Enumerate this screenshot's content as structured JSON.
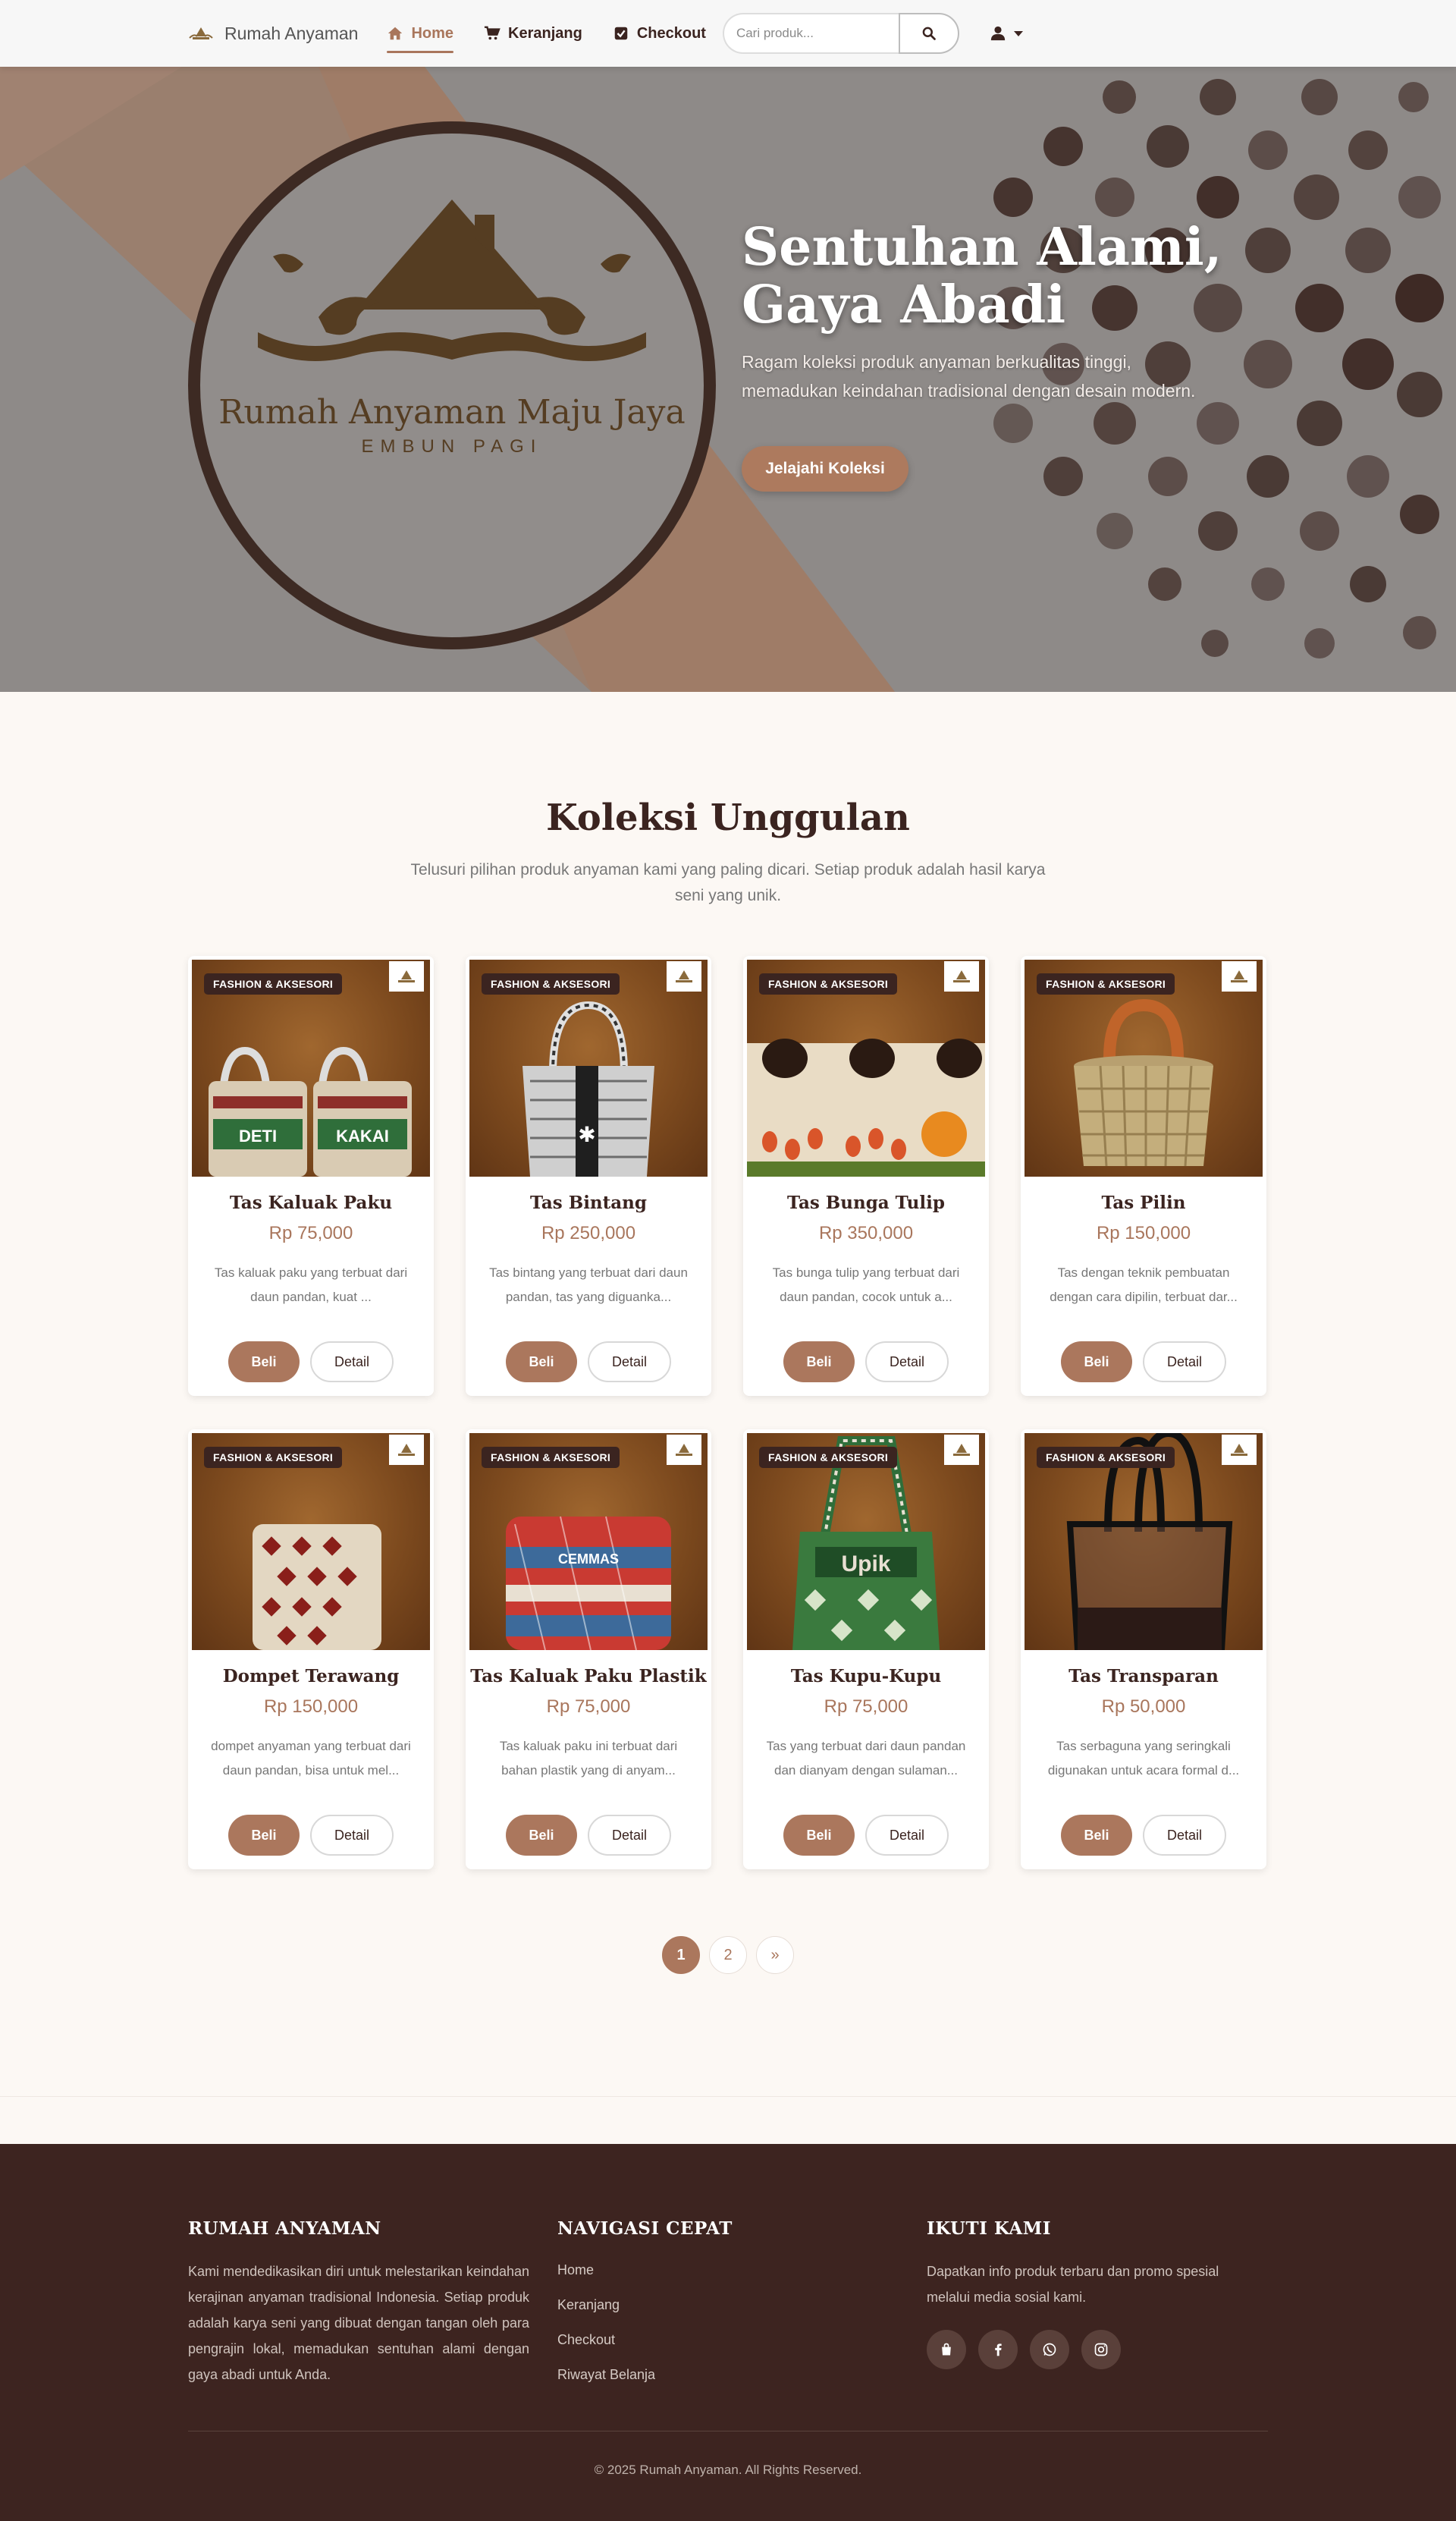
{
  "navbar": {
    "brand": "Rumah Anyaman",
    "links": [
      {
        "label": "Home",
        "icon": "home-icon"
      },
      {
        "label": "Keranjang",
        "icon": "cart-icon"
      },
      {
        "label": "Checkout",
        "icon": "checkbox-icon"
      }
    ],
    "search_placeholder": "Cari produk...",
    "user_icon": "user-icon"
  },
  "hero": {
    "logo_title": "Rumah Anyaman Maju Jaya",
    "logo_subtitle": "EMBUN PAGI",
    "title": "Sentuhan Alami, Gaya Abadi",
    "subtitle": "Ragam koleksi produk anyaman berkualitas tinggi, memadukan keindahan tradisional dengan desain modern.",
    "cta": "Jelajahi Koleksi"
  },
  "collection": {
    "title": "Koleksi Unggulan",
    "subtitle": "Telusuri pilihan produk anyaman kami yang paling dicari. Setiap produk adalah hasil karya seni yang unik.",
    "products": [
      {
        "badge": "FASHION & AKSESORI",
        "name": "Tas Kaluak Paku",
        "price": "Rp 75,000",
        "desc": "Tas kaluak paku yang terbuat dari daun pandan, kuat ...",
        "buy": "Beli",
        "detail": "Detail"
      },
      {
        "badge": "FASHION & AKSESORI",
        "name": "Tas Bintang",
        "price": "Rp 250,000",
        "desc": "Tas bintang yang terbuat dari daun pandan, tas yang diguanka...",
        "buy": "Beli",
        "detail": "Detail"
      },
      {
        "badge": "FASHION & AKSESORI",
        "name": "Tas Bunga Tulip",
        "price": "Rp 350,000",
        "desc": "Tas bunga tulip yang terbuat dari daun pandan, cocok untuk a...",
        "buy": "Beli",
        "detail": "Detail"
      },
      {
        "badge": "FASHION & AKSESORI",
        "name": "Tas Pilin",
        "price": "Rp 150,000",
        "desc": "Tas dengan teknik pembuatan dengan cara dipilin, terbuat dar...",
        "buy": "Beli",
        "detail": "Detail"
      },
      {
        "badge": "FASHION & AKSESORI",
        "name": "Dompet Terawang",
        "price": "Rp 150,000",
        "desc": "dompet anyaman yang terbuat dari daun pandan, bisa untuk mel...",
        "buy": "Beli",
        "detail": "Detail"
      },
      {
        "badge": "FASHION & AKSESORI",
        "name": "Tas Kaluak Paku Plastik",
        "price": "Rp 75,000",
        "desc": "Tas kaluak paku ini terbuat dari bahan plastik yang di anyam...",
        "buy": "Beli",
        "detail": "Detail"
      },
      {
        "badge": "FASHION & AKSESORI",
        "name": "Tas Kupu-Kupu",
        "price": "Rp 75,000",
        "desc": "Tas yang terbuat dari daun pandan dan dianyam dengan sulaman...",
        "buy": "Beli",
        "detail": "Detail"
      },
      {
        "badge": "FASHION & AKSESORI",
        "name": "Tas Transparan",
        "price": "Rp 50,000",
        "desc": "Tas serbaguna yang seringkali digunakan untuk acara formal d...",
        "buy": "Beli",
        "detail": "Detail"
      }
    ]
  },
  "pagination": {
    "pages": [
      "1",
      "2",
      "»"
    ],
    "current": "1"
  },
  "footer": {
    "about_title": "RUMAH ANYAMAN",
    "about_text": "Kami mendedikasikan diri untuk melestarikan keindahan kerajinan anyaman tradisional Indonesia. Setiap produk adalah karya seni yang dibuat dengan tangan oleh para pengrajin lokal, memadukan sentuhan alami dengan gaya abadi untuk Anda.",
    "nav_title": "NAVIGASI CEPAT",
    "nav_links": [
      "Home",
      "Keranjang",
      "Checkout",
      "Riwayat Belanja"
    ],
    "social_title": "IKUTI KAMI",
    "social_text": "Dapatkan info produk terbaru dan promo spesial melalui media sosial kami.",
    "social_icons": [
      "shop-icon",
      "facebook-icon",
      "whatsapp-icon",
      "instagram-icon"
    ],
    "copyright": "© 2025 Rumah Anyaman. All Rights Reserved."
  },
  "colors": {
    "accent": "#ab775d",
    "dark": "#3d2420",
    "background": "#fcf8f4"
  }
}
